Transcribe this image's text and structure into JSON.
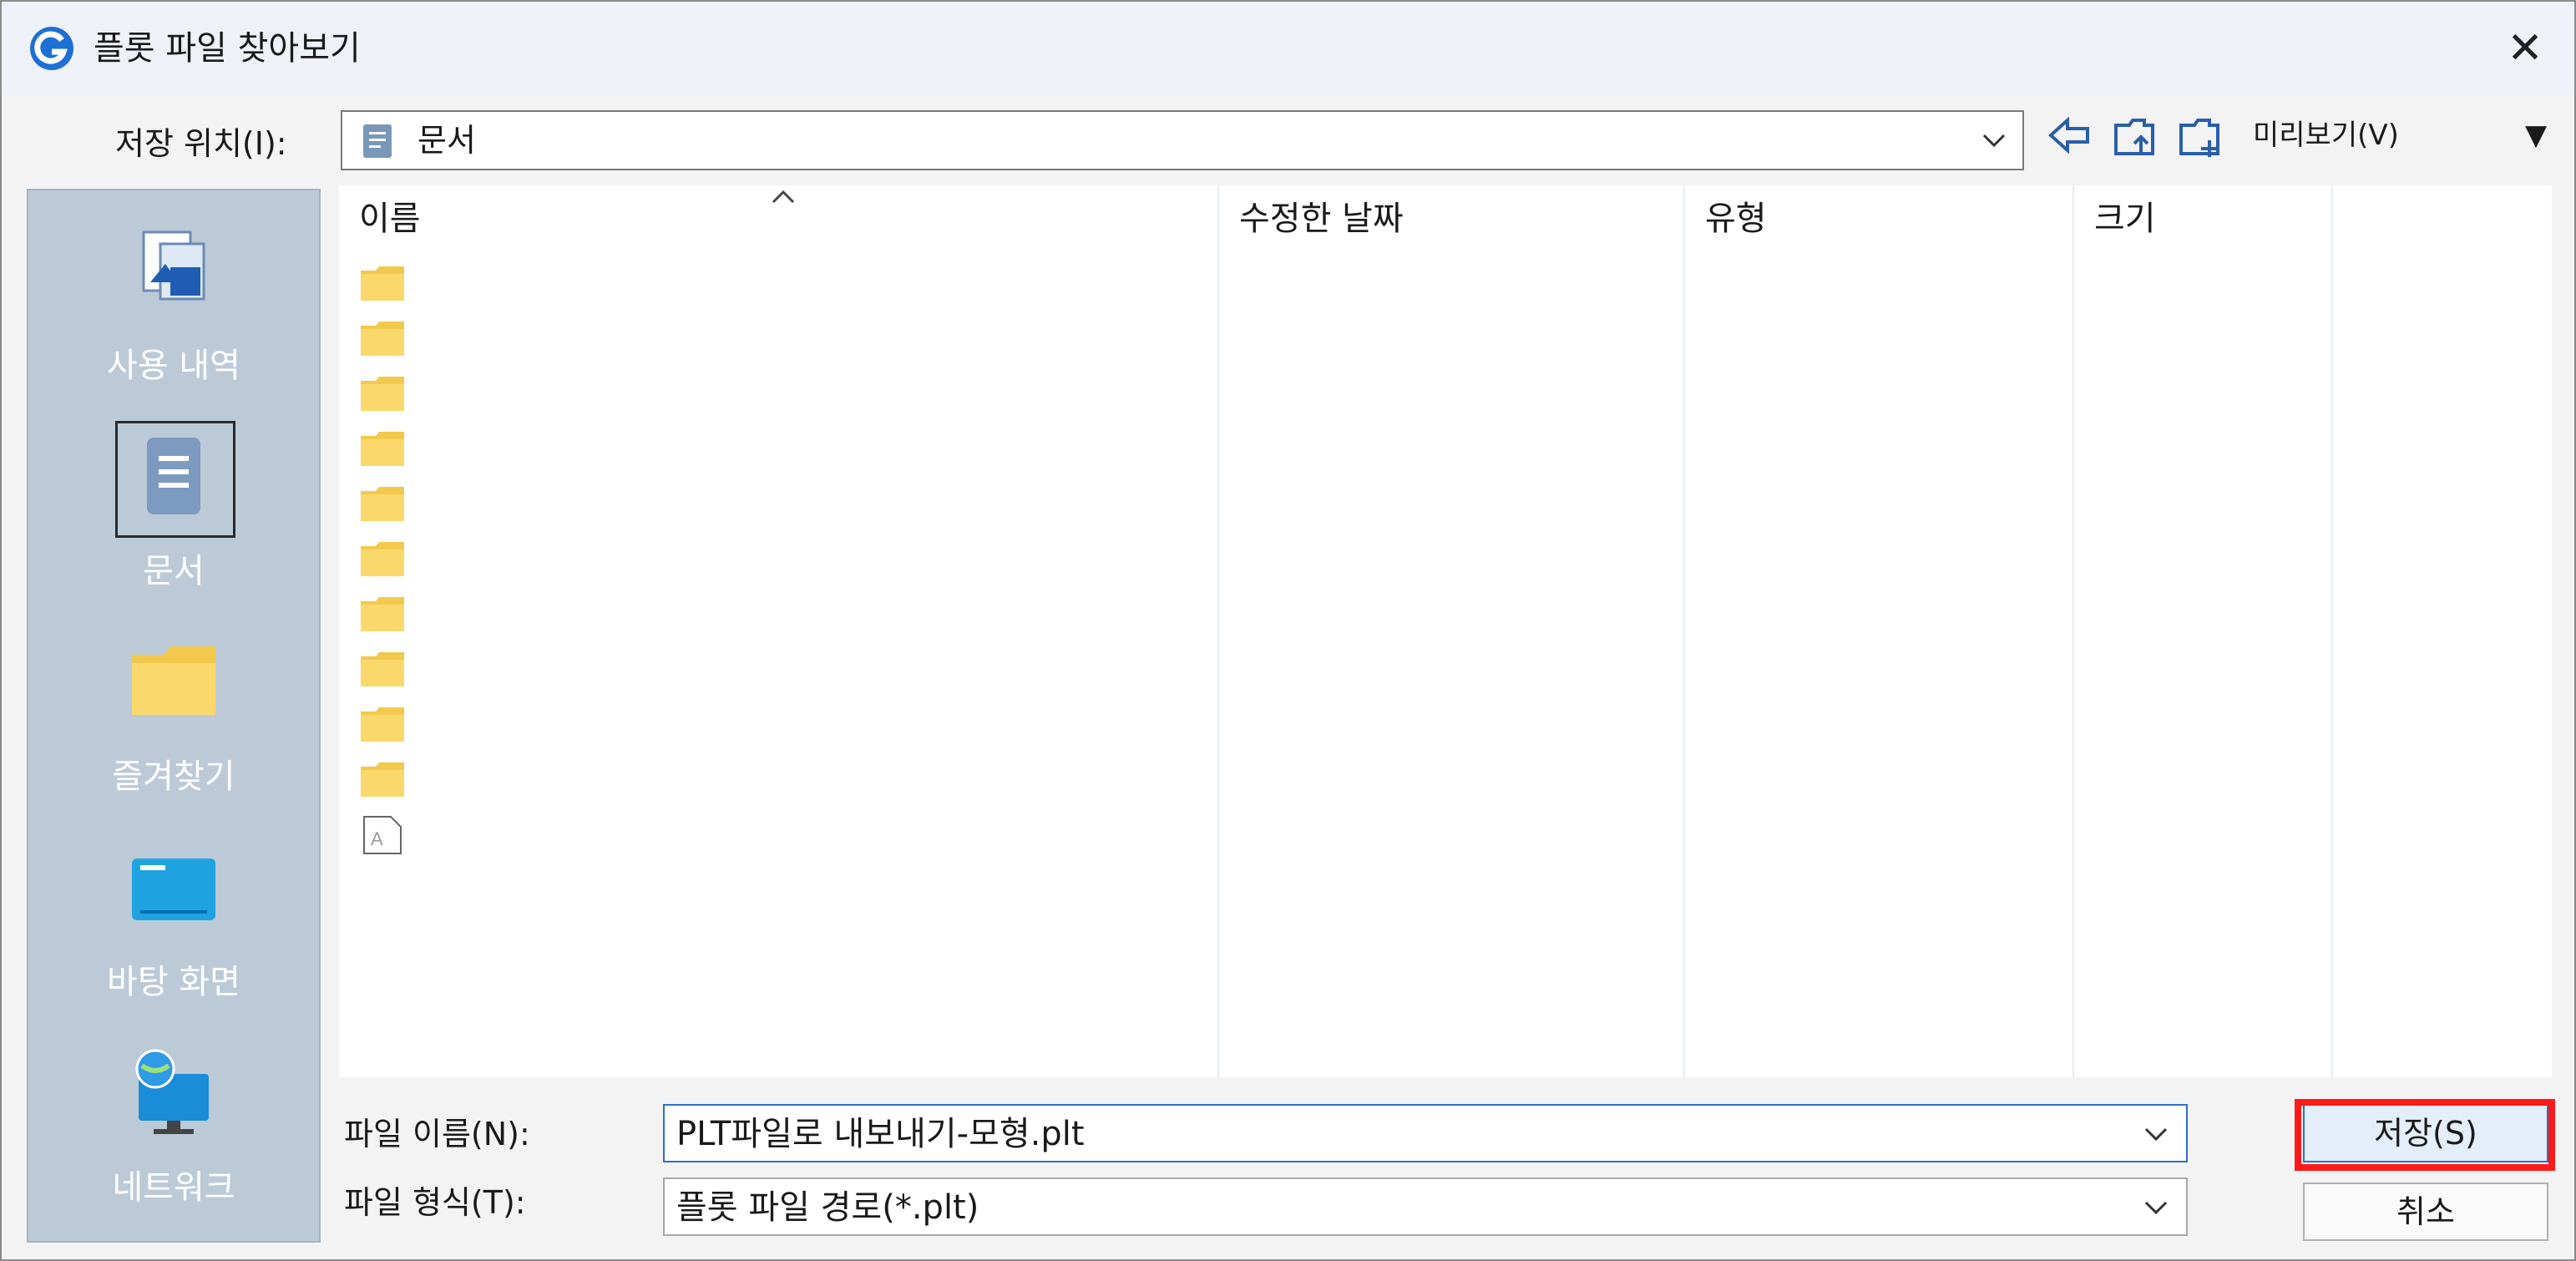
{
  "window": {
    "title": "플롯 파일 찾아보기",
    "close_glyph": "✕"
  },
  "location": {
    "label": "저장 위치(I):",
    "value": "문서"
  },
  "toolbar": {
    "preview_label": "미리보기(V)",
    "preview_arrow": "▼",
    "icons": [
      "back-arrow-icon",
      "up-folder-icon",
      "new-folder-icon"
    ]
  },
  "places": [
    {
      "label": "사용 내역",
      "icon": "recent-icon"
    },
    {
      "label": "문서",
      "icon": "documents-icon",
      "selected": true
    },
    {
      "label": "즐겨찾기",
      "icon": "favorites-folder-icon"
    },
    {
      "label": "바탕 화면",
      "icon": "desktop-icon"
    },
    {
      "label": "네트워크",
      "icon": "network-icon"
    }
  ],
  "columns": [
    "이름",
    "수정한 날짜",
    "유형",
    "크기"
  ],
  "files": [
    {
      "icon": "folder-icon"
    },
    {
      "icon": "folder-icon"
    },
    {
      "icon": "folder-icon"
    },
    {
      "icon": "folder-icon"
    },
    {
      "icon": "folder-icon"
    },
    {
      "icon": "folder-icon"
    },
    {
      "icon": "folder-icon"
    },
    {
      "icon": "folder-icon"
    },
    {
      "icon": "folder-icon"
    },
    {
      "icon": "folder-icon"
    },
    {
      "icon": "drawing-file-icon"
    }
  ],
  "filename": {
    "label": "파일 이름(N):",
    "value": "PLT파일로 내보내기-모형.plt"
  },
  "filetype": {
    "label": "파일 형식(T):",
    "value": "플롯 파일 경로(*.plt)"
  },
  "buttons": {
    "save": "저장(S)",
    "cancel": "취소"
  },
  "colors": {
    "accent": "#2c6fc9",
    "highlight": "#ff1a1a",
    "places_bg": "#bccad8"
  }
}
